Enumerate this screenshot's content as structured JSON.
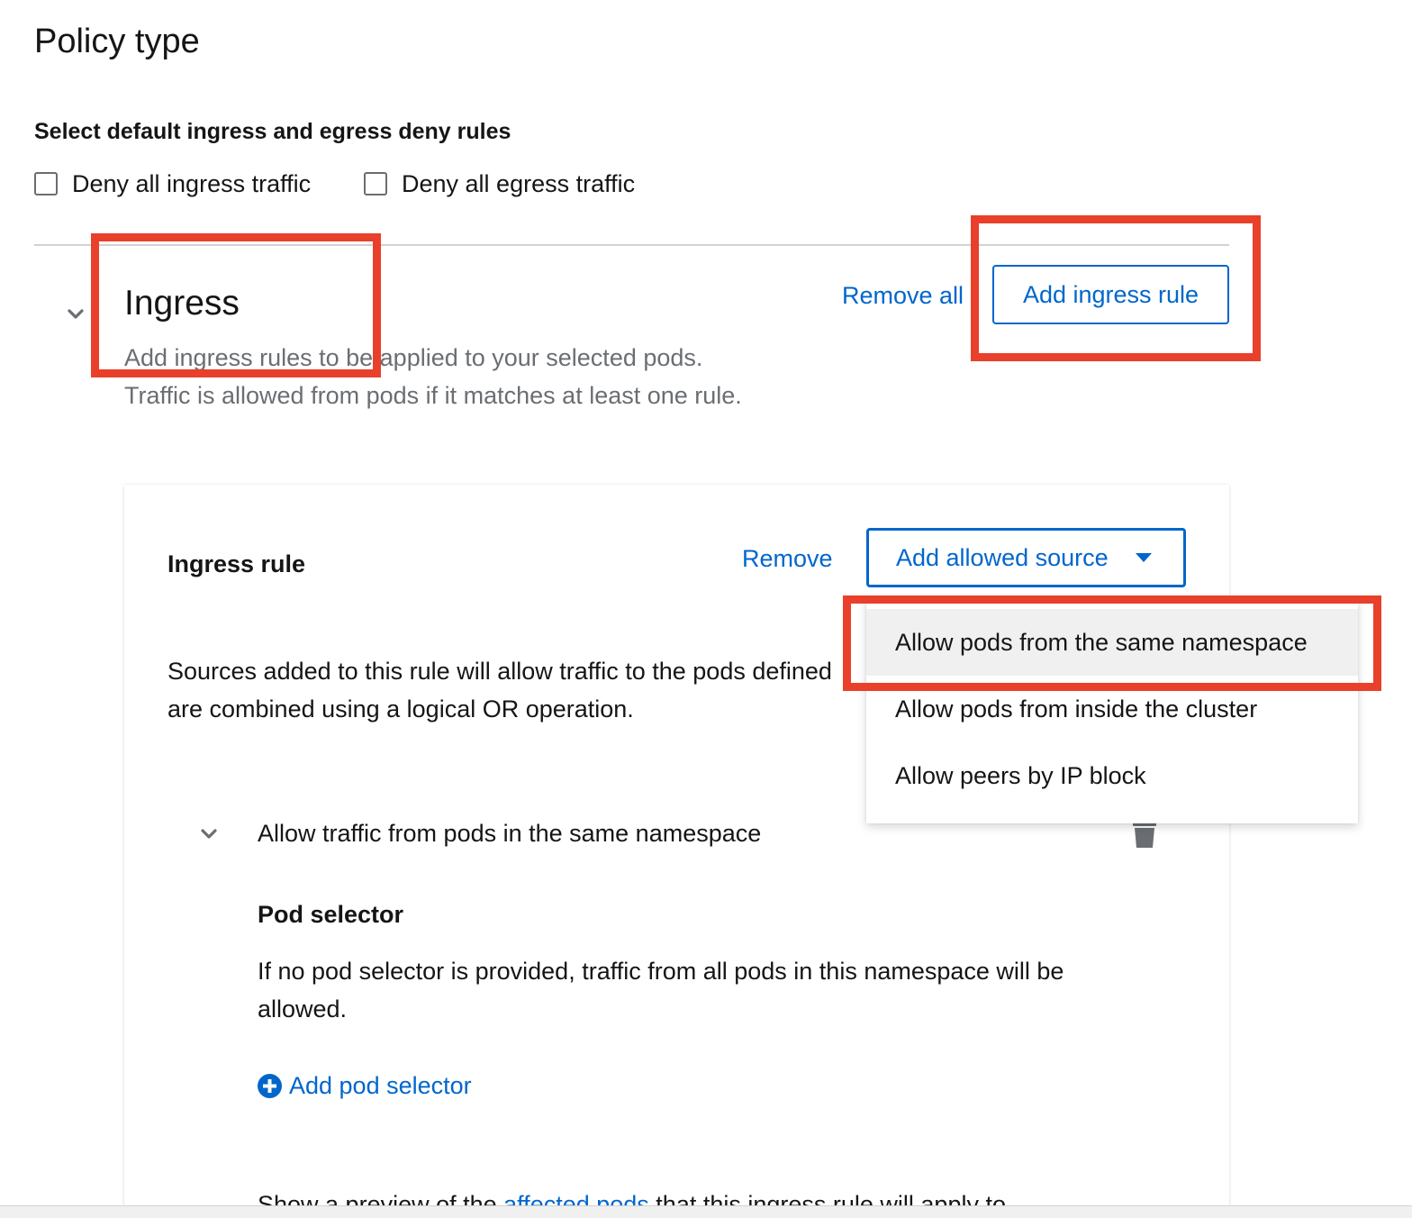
{
  "page": {
    "title": "Policy type"
  },
  "policy_type": {
    "section_label": "Select default ingress and egress deny rules",
    "deny_ingress_label": "Deny all ingress traffic",
    "deny_ingress_checked": false,
    "deny_egress_label": "Deny all egress traffic",
    "deny_egress_checked": false
  },
  "ingress": {
    "title": "Ingress",
    "description_line1": "Add ingress rules to be applied to your selected pods.",
    "description_line2": "Traffic is allowed from pods if it matches at least one rule.",
    "remove_all_label": "Remove all",
    "add_rule_label": "Add ingress rule"
  },
  "rule": {
    "title": "Ingress rule",
    "remove_label": "Remove",
    "add_source_label": "Add allowed source",
    "description_line1": "Sources added to this rule will allow traffic to the pods defined",
    "description_line2": "are combined using a logical OR operation.",
    "source_title": "Allow traffic from pods in the same namespace",
    "pod_selector_title": "Pod selector",
    "pod_selector_description": "If no pod selector is provided, traffic from all pods in this namespace will be allowed.",
    "add_pod_selector_label": "Add pod selector",
    "preview_before": "Show a preview of the ",
    "preview_link": "affected pods",
    "preview_after": " that this ingress rule will apply to"
  },
  "dropdown": {
    "items": [
      {
        "label": "Allow pods from the same namespace",
        "hovered": true
      },
      {
        "label": "Allow pods from inside the cluster",
        "hovered": false
      },
      {
        "label": "Allow peers by IP block",
        "hovered": false
      }
    ]
  },
  "colors": {
    "link": "#0066cc",
    "highlight": "#e8402a",
    "muted_text": "#6a6e73"
  }
}
